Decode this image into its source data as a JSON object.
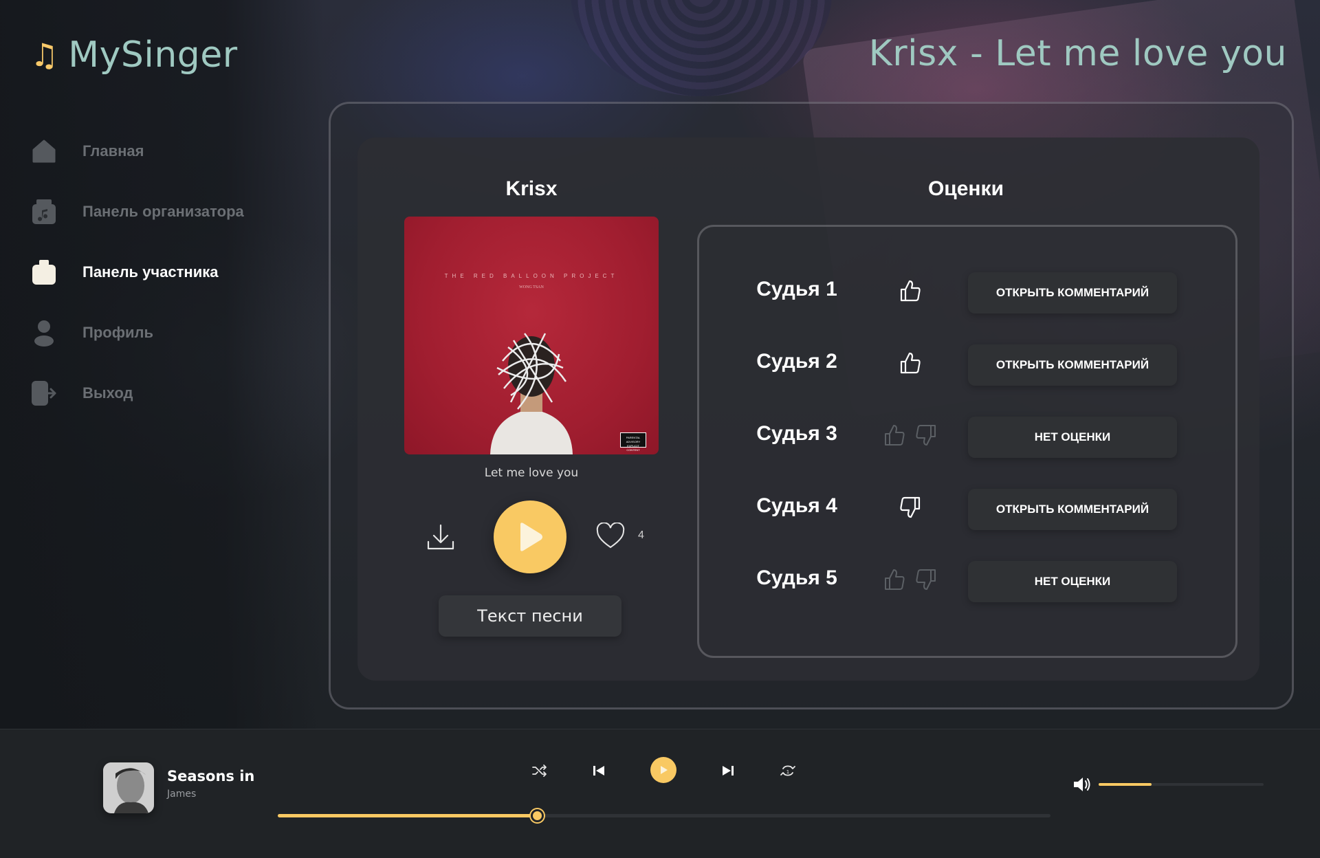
{
  "app": {
    "name": "MySinger",
    "logo_icon": "music-note-icon",
    "page_title": "Krisx - Let me love you"
  },
  "colors": {
    "accent": "#f9c963",
    "brand_text": "#9fc9c1",
    "muted_nav": "#6b6f74"
  },
  "sidebar": {
    "items": [
      {
        "label": "Главная",
        "icon": "home-icon",
        "active": false
      },
      {
        "label": "Панель организатора",
        "icon": "music-folder-icon",
        "active": false
      },
      {
        "label": "Панель участника",
        "icon": "radio-icon",
        "active": true
      },
      {
        "label": "Профиль",
        "icon": "user-icon",
        "active": false
      },
      {
        "label": "Выход",
        "icon": "logout-icon",
        "active": false
      }
    ]
  },
  "track": {
    "artist": "Krisx",
    "cover_title": "THE RED BALLOON PROJECT",
    "cover_subtitle": "WONG TSAN",
    "advisory": "PARENTAL ADVISORY EXPLICIT CONTENT",
    "title": "Let me love you",
    "likes": "4",
    "lyrics_button": "Текст песни"
  },
  "ratings": {
    "title": "Оценки",
    "judges": [
      {
        "name": "Судья 1",
        "vote": "like",
        "button": "Открыть комментарий"
      },
      {
        "name": "Судья 2",
        "vote": "like",
        "button": "Открыть комментарий"
      },
      {
        "name": "Судья 3",
        "vote": "none",
        "button": "Нет оценки"
      },
      {
        "name": "Судья 4",
        "vote": "dislike",
        "button": "Открыть комментарий"
      },
      {
        "name": "Судья 5",
        "vote": "none",
        "button": "Нет оценки"
      }
    ]
  },
  "player": {
    "title": "Seasons in",
    "artist": "James",
    "progress": 0.335,
    "volume": 0.32
  }
}
